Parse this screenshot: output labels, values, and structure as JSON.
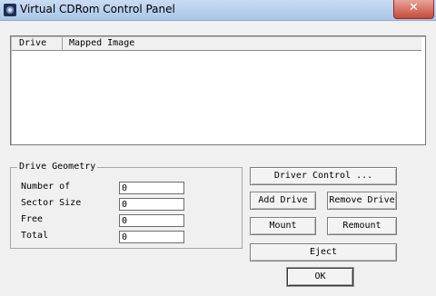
{
  "window": {
    "title": "Virtual CDRom Control Panel",
    "close_label": "✕"
  },
  "drive_list": {
    "columns": [
      "Drive",
      "Mapped Image"
    ]
  },
  "drive_geometry": {
    "title": "Drive Geometry",
    "fields": [
      {
        "label": "Number of",
        "value": "0"
      },
      {
        "label": "Sector Size",
        "value": "0"
      },
      {
        "label": "Free",
        "value": "0"
      },
      {
        "label": "Total",
        "value": "0"
      }
    ]
  },
  "buttons": {
    "driver_control": "Driver Control ...",
    "add_drive": "Add Drive",
    "remove_drive": "Remove Drive",
    "mount": "Mount",
    "remount": "Remount",
    "eject": "Eject",
    "ok": "OK"
  }
}
